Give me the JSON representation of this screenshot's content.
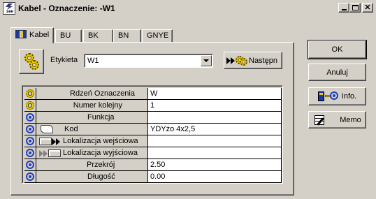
{
  "window": {
    "title": "Kabel - Oznaczenie: -W1",
    "app_icon_text": "see"
  },
  "tabs": [
    {
      "label": "Kabel",
      "active": true,
      "icon": "cable-icon"
    },
    {
      "label": "BU"
    },
    {
      "label": "BK"
    },
    {
      "label": "BN"
    },
    {
      "label": "GNYE"
    }
  ],
  "label_row": {
    "label": "Etykieta",
    "value": "W1",
    "next_button": "Następn"
  },
  "grid": {
    "rows": [
      {
        "name": "Rdzeń Oznaczenia",
        "value": "W",
        "icon": "gear-icon"
      },
      {
        "name": "Numer kolejny",
        "value": "1",
        "icon": "gear-icon"
      },
      {
        "name": "Funkcja",
        "value": "",
        "icon": "link-icon"
      },
      {
        "name": "Kod",
        "value": "YDYżo 4x2,5",
        "icon": "link-icon",
        "extra_icon": "book-icon"
      },
      {
        "name": "Lokalizacja wejściowa",
        "value": "",
        "icon": "link-icon",
        "extra_icon": "location-in-icon"
      },
      {
        "name": "Lokalizacja wyjściowa",
        "value": "",
        "icon": "link-icon",
        "extra_icon": "location-out-icon"
      },
      {
        "name": "Przekrój",
        "value": "2.50",
        "icon": "link-icon"
      },
      {
        "name": "Długość",
        "value": "0.00",
        "icon": "link-icon"
      }
    ]
  },
  "buttons": {
    "ok": "OK",
    "cancel": "Anuluj",
    "info": "Info.",
    "memo": "Memo"
  }
}
